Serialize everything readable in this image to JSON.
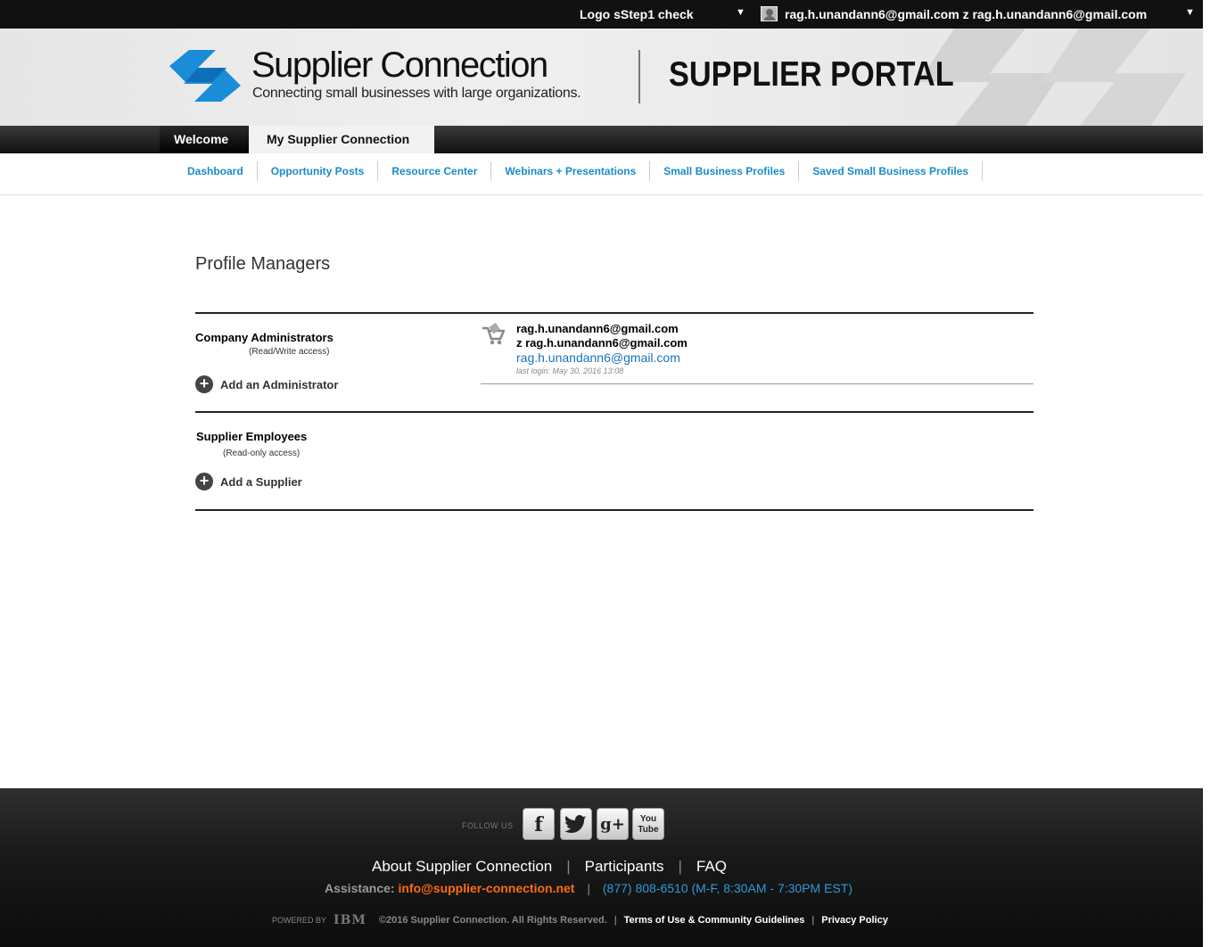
{
  "topbar": {
    "org_label": "Logo  sStep1 check",
    "org_caret": "▼",
    "user_label": "rag.h.unandann6@gmail.com z rag.h.unandann6@gmail.com",
    "user_caret": "▼"
  },
  "header": {
    "brand": "Supplier Connection",
    "tagline": "Connecting small businesses with large organizations.",
    "portal_title": "SUPPLIER PORTAL",
    "brand_color": "#1a8cd8"
  },
  "main_nav": {
    "tabs": [
      {
        "label": "Welcome",
        "active": false
      },
      {
        "label": "My Supplier Connection",
        "active": true
      }
    ]
  },
  "sub_nav": {
    "links": [
      "Dashboard",
      "Opportunity Posts",
      "Resource Center",
      "Webinars + Presentations",
      "Small Business Profiles",
      "Saved Small Business Profiles"
    ]
  },
  "content": {
    "title": "Profile Managers",
    "admins": {
      "label": "Company Administrators",
      "sub": "(Read/Write access)",
      "add_label": "Add an Administrator",
      "entries": [
        {
          "name_line1": "rag.h.unandann6@gmail.com",
          "name_line2": "z rag.h.unandann6@gmail.com",
          "email": "rag.h.unandann6@gmail.com",
          "last_login": "last login: May 30, 2016 13:08"
        }
      ]
    },
    "employees": {
      "label": "Supplier Employees",
      "sub": "(Read-only access)",
      "add_label": "Add a Supplier"
    }
  },
  "footer": {
    "follow_label": "FOLLOW US",
    "social": [
      {
        "name": "facebook-icon",
        "glyph": "f"
      },
      {
        "name": "twitter-icon",
        "glyph": "🐦"
      },
      {
        "name": "google-plus-icon",
        "glyph": "g+"
      },
      {
        "name": "youtube-icon",
        "glyph": "You Tube"
      }
    ],
    "nav": [
      "About Supplier Connection",
      "Participants",
      "FAQ"
    ],
    "assistance_label": "Assistance:",
    "assistance_email": "info@supplier-connection.net",
    "assistance_phone": "(877) 808-6510 (M-F, 8:30AM - 7:30PM EST)",
    "powered_by": "POWERED BY",
    "ibm": "IBM",
    "copyright": "©2016 Supplier Connection. All Rights Reserved.",
    "terms": "Terms of Use & Community Guidelines",
    "privacy": "Privacy Policy"
  }
}
